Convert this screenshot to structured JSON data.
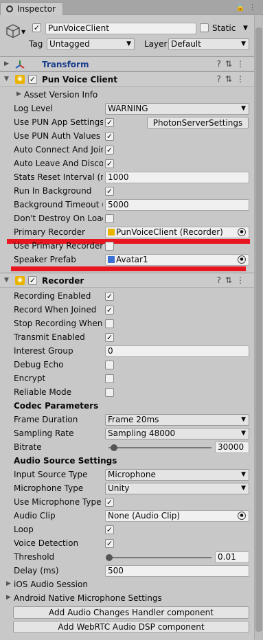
{
  "tab": {
    "title": "Inspector"
  },
  "object": {
    "name": "PunVoiceClient",
    "static_label": "Static",
    "tag_label": "Tag",
    "tag_value": "Untagged",
    "layer_label": "Layer",
    "layer_value": "Default"
  },
  "transform": {
    "title": "Transform"
  },
  "pun_voice_client": {
    "title": "Pun Voice Client",
    "asset_version_info": "Asset Version Info",
    "log_level_label": "Log Level",
    "log_level_value": "WARNING",
    "use_pun_app_settings_label": "Use PUN App Settings",
    "photon_server_settings_button": "PhotonServerSettings",
    "use_pun_auth_values_label": "Use PUN Auth Values",
    "auto_connect_label": "Auto Connect And Join",
    "auto_leave_label": "Auto Leave And Disconnect",
    "stats_reset_label": "Stats Reset Interval (ms)",
    "stats_reset_value": "1000",
    "run_in_background_label": "Run In Background",
    "background_timeout_label": "Background Timeout (ms)",
    "background_timeout_value": "5000",
    "dont_destroy_label": "Don't Destroy On Load",
    "primary_recorder_label": "Primary Recorder",
    "primary_recorder_value": "PunVoiceClient (Recorder)",
    "use_primary_recorder_label": "Use Primary Recorder",
    "speaker_prefab_label": "Speaker Prefab",
    "speaker_prefab_value": "Avatar1"
  },
  "recorder": {
    "title": "Recorder",
    "recording_enabled_label": "Recording Enabled",
    "record_when_joined_label": "Record When Joined",
    "stop_recording_label": "Stop Recording When Paused",
    "transmit_enabled_label": "Transmit Enabled",
    "interest_group_label": "Interest Group",
    "interest_group_value": "0",
    "debug_echo_label": "Debug Echo",
    "encrypt_label": "Encrypt",
    "reliable_mode_label": "Reliable Mode",
    "codec_parameters_heading": "Codec Parameters",
    "frame_duration_label": "Frame Duration",
    "frame_duration_value": "Frame 20ms",
    "sampling_rate_label": "Sampling Rate",
    "sampling_rate_value": "Sampling 48000",
    "bitrate_label": "Bitrate",
    "bitrate_value": "30000",
    "audio_source_heading": "Audio Source Settings",
    "input_source_type_label": "Input Source Type",
    "input_source_type_value": "Microphone",
    "microphone_type_label": "Microphone Type",
    "microphone_type_value": "Unity",
    "use_mic_type_fallback_label": "Use Microphone Type Fallback",
    "audio_clip_label": "Audio Clip",
    "audio_clip_value": "None (Audio Clip)",
    "loop_label": "Loop",
    "voice_detection_label": "Voice Detection",
    "threshold_label": "Threshold",
    "threshold_value": "0.01",
    "delay_label": "Delay (ms)",
    "delay_value": "500",
    "ios_audio_session_label": "iOS Audio Session",
    "android_mic_settings_label": "Android Native Microphone Settings",
    "add_audio_changes_button": "Add Audio Changes Handler component",
    "add_webrtc_button": "Add WebRTC Audio DSP component"
  },
  "state": {
    "use_pun_app_settings": true,
    "use_pun_auth_values": true,
    "auto_connect": true,
    "auto_leave": true,
    "run_in_background": true,
    "dont_destroy": false,
    "use_primary_recorder": false,
    "recording_enabled": true,
    "record_when_joined": true,
    "stop_recording": false,
    "transmit_enabled": true,
    "debug_echo": false,
    "encrypt": false,
    "reliable_mode": false,
    "use_mic_type_fallback": true,
    "loop": true,
    "voice_detection": true,
    "bitrate_level": 0.05,
    "threshold_level": 0.02
  },
  "colors": {
    "highlight_line": "#e8141e",
    "component_icon": "#e8b400",
    "transform_title": "#1a3d8c"
  }
}
